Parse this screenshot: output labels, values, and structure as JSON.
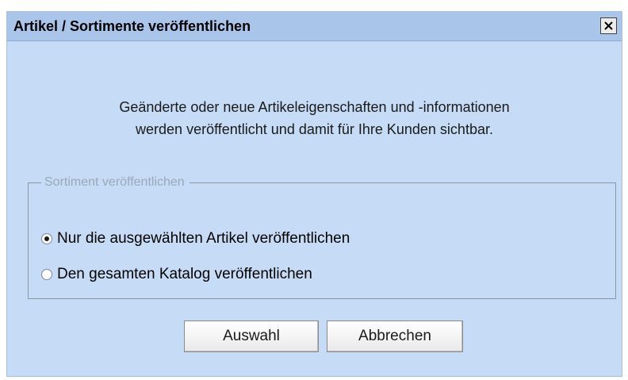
{
  "dialog": {
    "title": "Artikel / Sortimente veröffentlichen",
    "close_icon": "close-icon"
  },
  "message": {
    "line1": "Geänderte oder neue Artikeleigenschaften und -informationen",
    "line2": "werden veröffentlicht und damit für Ihre Kunden sichtbar."
  },
  "group": {
    "legend": "Sortiment veröffentlichen",
    "options": [
      {
        "label": "Nur die ausgewählten Artikel veröffentlichen",
        "checked": true
      },
      {
        "label": "Den gesamten Katalog veröffentlichen",
        "checked": false
      }
    ]
  },
  "buttons": {
    "ok_label": "Auswahl",
    "cancel_label": "Abbrechen"
  },
  "colors": {
    "dialog_background": "#c6dbf5",
    "titlebar_background": "#a9c5ea"
  }
}
